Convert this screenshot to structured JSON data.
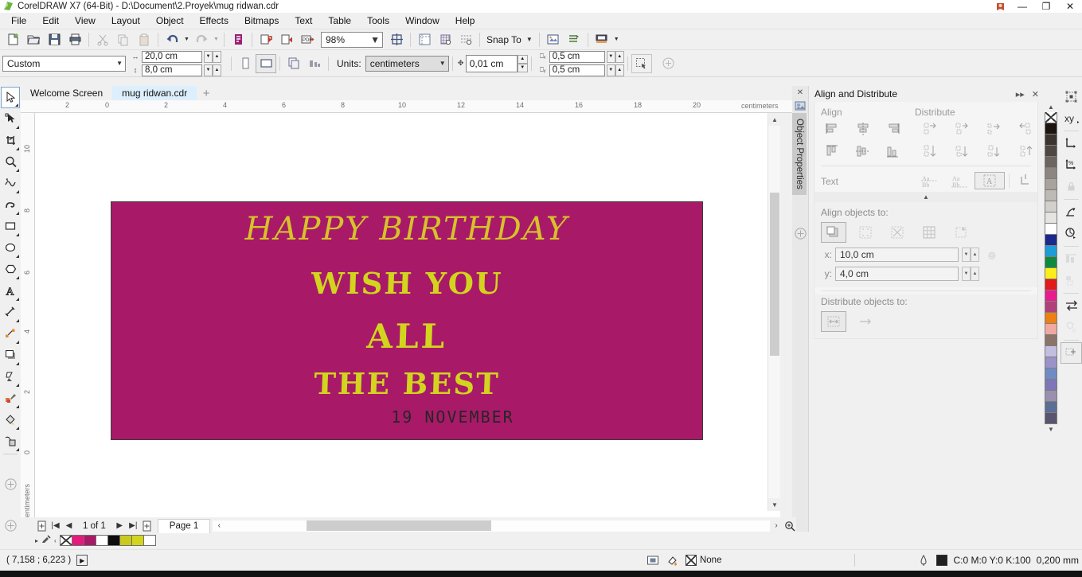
{
  "window": {
    "title": "CorelDRAW X7 (64-Bit) - D:\\Document\\2.Proyek\\mug ridwan.cdr",
    "minimize": "—",
    "restore": "❐",
    "close": "✕"
  },
  "menubar": {
    "items": [
      "File",
      "Edit",
      "View",
      "Layout",
      "Object",
      "Effects",
      "Bitmaps",
      "Text",
      "Table",
      "Tools",
      "Window",
      "Help"
    ]
  },
  "toolbar": {
    "new_label": "New",
    "open_label": "Open",
    "save_label": "Save",
    "print_label": "Print",
    "cut_label": "Cut",
    "copy_label": "Copy",
    "paste_label": "Paste",
    "undo_label": "Undo",
    "redo_label": "Redo",
    "search_label": "Search content",
    "import_label": "Import",
    "export_label": "Export",
    "pdf_label": "Publish to PDF",
    "zoom_level": "98%",
    "zoom_fit_label": "Zoom to fit",
    "options_label": "Options",
    "snap_to_label": "Snap To",
    "view_label": "Full-screen preview",
    "objmgr_label": "Object manager",
    "app_launcher_label": "Application launcher"
  },
  "propertybar": {
    "page_preset": "Custom",
    "page_width": "20,0 cm",
    "page_height": "8,0 cm",
    "orientation_portrait_label": "Portrait",
    "orientation_landscape_label": "Landscape",
    "all_pages_label": "All pages",
    "current_page_label": "Current page",
    "units_label": "Units:",
    "units_value": "centimeters",
    "nudge_value": "0,01 cm",
    "duplicate_x": "0,5 cm",
    "duplicate_y": "0,5 cm",
    "edit_area_label": "Edit page border",
    "plus_label": "Add"
  },
  "tabs": {
    "items": [
      {
        "label": "Welcome Screen",
        "active": false
      },
      {
        "label": "mug ridwan.cdr",
        "active": true
      }
    ],
    "add_label": "+"
  },
  "toolbox": {
    "tools": [
      {
        "name": "pick-tool",
        "label": "Pick"
      },
      {
        "name": "shape-tool",
        "label": "Shape"
      },
      {
        "name": "crop-tool",
        "label": "Crop"
      },
      {
        "name": "zoom-tool",
        "label": "Zoom"
      },
      {
        "name": "freehand-tool",
        "label": "Freehand"
      },
      {
        "name": "artistic-media-tool",
        "label": "Artistic Media"
      },
      {
        "name": "rectangle-tool",
        "label": "Rectangle"
      },
      {
        "name": "ellipse-tool",
        "label": "Ellipse"
      },
      {
        "name": "polygon-tool",
        "label": "Polygon"
      },
      {
        "name": "text-tool",
        "label": "Text"
      },
      {
        "name": "parallel-dimension-tool",
        "label": "Parallel Dimension"
      },
      {
        "name": "straight-line-connector-tool",
        "label": "Straight-Line Connector"
      },
      {
        "name": "drop-shadow-tool",
        "label": "Drop Shadow"
      },
      {
        "name": "transparency-tool",
        "label": "Transparency"
      },
      {
        "name": "color-eyedropper-tool",
        "label": "Color Eyedropper"
      },
      {
        "name": "interactive-fill-tool",
        "label": "Interactive Fill"
      },
      {
        "name": "smart-fill-tool",
        "label": "Smart Fill"
      }
    ],
    "quick_customize": "+"
  },
  "rulers": {
    "horizontal_ticks": [
      "2",
      "0",
      "2",
      "4",
      "6",
      "8",
      "10",
      "12",
      "14",
      "16",
      "18",
      "20"
    ],
    "horizontal_unit": "centimeters",
    "vertical_ticks": [
      "10",
      "8",
      "6",
      "4",
      "2",
      "0"
    ],
    "vertical_unit": "centimeters"
  },
  "artwork": {
    "background_color": "#A81A68",
    "text_color": "#D2D41E",
    "date_color": "#262626",
    "lines": {
      "title": "HAPPY BIRTHDAY",
      "line2": "WISH YOU",
      "line3": "ALL",
      "line4": "THE BEST",
      "date": "19 NOVEMBER"
    }
  },
  "docker": {
    "title": "Align and Distribute",
    "collapse_label": "▸▸",
    "close_label": "✕",
    "vertical_tab": "Align and Distribute",
    "object_properties_tab": "Object Properties",
    "align_label": "Align",
    "distribute_label": "Distribute",
    "text_label": "Text",
    "align_objects_to_label": "Align objects to:",
    "distribute_objects_to_label": "Distribute objects to:",
    "x_label": "x:",
    "y_label": "y:",
    "x_value": "10,0 cm",
    "y_value": "4,0 cm",
    "align_buttons": [
      "align-left",
      "align-center-horizontal",
      "align-right",
      "align-top",
      "align-center-vertical",
      "align-bottom"
    ],
    "distribute_buttons": [
      "distribute-left",
      "distribute-center-h",
      "distribute-space-h",
      "distribute-right",
      "distribute-top",
      "distribute-center-v",
      "distribute-space-v",
      "distribute-bottom"
    ],
    "text_buttons": [
      "text-first-line-baseline",
      "text-last-line-baseline",
      "text-bounding-box",
      "text-outline"
    ],
    "align_targets": [
      "active-objects",
      "edge-of-page",
      "center-of-page",
      "grid",
      "specified-point"
    ],
    "distribute_targets": [
      "extent-of-selection",
      "extent-of-page"
    ]
  },
  "right_tools": {
    "items": [
      {
        "name": "object-coordinates-icon",
        "label": "Object coordinates"
      },
      {
        "name": "transform-position-icon",
        "label": "xy"
      },
      {
        "name": "transform-size-icon",
        "label": "Size"
      },
      {
        "name": "transform-scale-icon",
        "label": "Scale"
      },
      {
        "name": "lock-ratio-icon",
        "label": "Lock ratio"
      },
      {
        "name": "transform-rotate-icon",
        "label": "Rotate"
      },
      {
        "name": "transform-skew-icon",
        "label": "Skew"
      },
      {
        "name": "align-icon",
        "label": "Align"
      },
      {
        "name": "distribute-icon",
        "label": "Distribute"
      },
      {
        "name": "order-icon",
        "label": "Order"
      },
      {
        "name": "shaping-icon",
        "label": "Shaping"
      },
      {
        "name": "add-preset-icon",
        "label": "Add preset"
      }
    ]
  },
  "palette": {
    "scroll_up": "▲",
    "scroll_down": "▼",
    "swatches": [
      "none",
      "#1C1410",
      "#3A332E",
      "#4F4742",
      "#6C6560",
      "#8C8680",
      "#A7A29C",
      "#BDB9B4",
      "#D3D0CC",
      "#E6E4E1",
      "#FFFFFF",
      "#1A2A8C",
      "#1E9CD7",
      "#0E8A3E",
      "#FBEF1B",
      "#E01B1B",
      "#E81C8C",
      "#B0407A",
      "#EE8012",
      "#F0A8A0",
      "#8A7368",
      "#C3BEE0",
      "#9A92C8",
      "#6F8BC4",
      "#7E76B6",
      "#9A8FAE",
      "#5C6E96",
      "#5A5470"
    ]
  },
  "pagebar": {
    "add_page_start": "Add page at start",
    "first_label": "First page",
    "prev_label": "Previous page",
    "counter": "1 of 1",
    "next_label": "Next page",
    "last_label": "Last page",
    "add_page_end": "Add page at end",
    "page_tab": "Page 1",
    "scroll_left": "‹",
    "scroll_right": "›",
    "zoom_label": "Zoom"
  },
  "colorstrip": {
    "swatches": [
      "none",
      "#E6197C",
      "#A81A68",
      "#FFFFFF",
      "#0D0D0D",
      "#C9C91E",
      "#D2D41E",
      "#FFFFFF"
    ],
    "eyedropper_label": "Color eyedropper",
    "expand_label": "▸"
  },
  "statusbar": {
    "coordinates": "( 7,158 ; 6,223 )",
    "play_label": "▶",
    "fill_label": "None",
    "outline_color_model": "C:0 M:0 Y:0 K:100",
    "outline_width": "0,200 mm",
    "outline_swatch": "#231f20"
  }
}
